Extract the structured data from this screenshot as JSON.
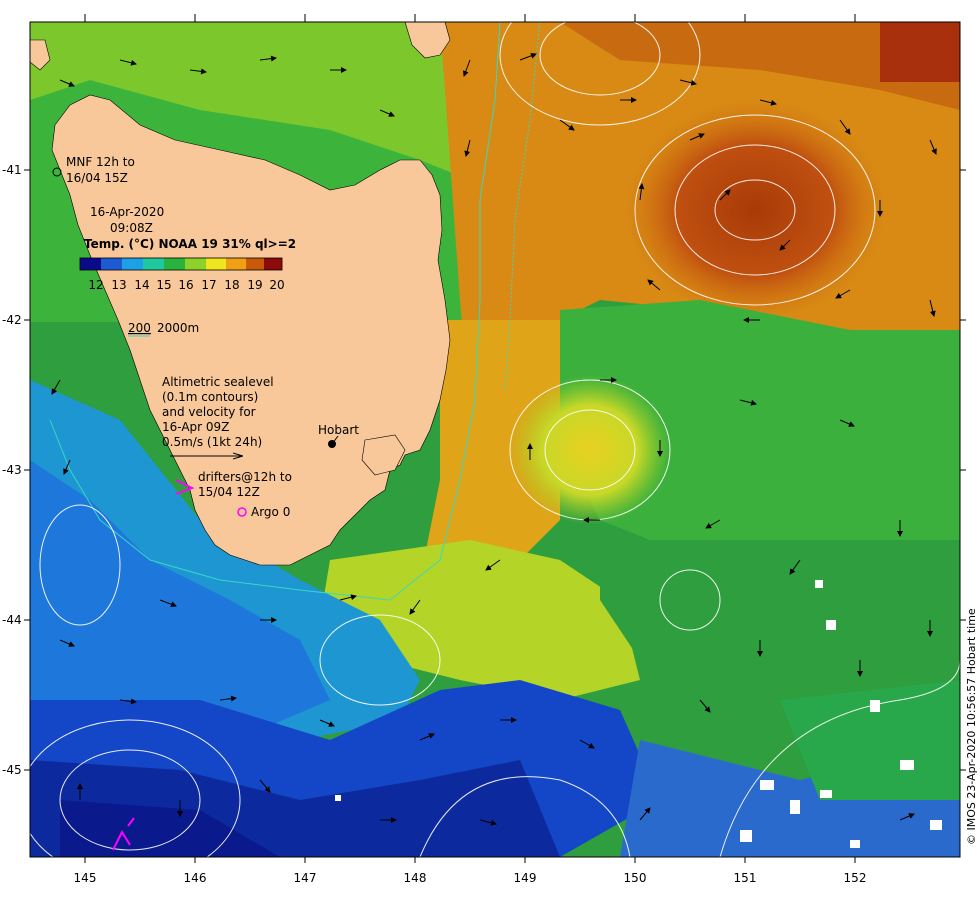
{
  "map": {
    "mooring_label_1": "MNF 12h to",
    "mooring_label_2": "16/04 15Z",
    "date": "16-Apr-2020",
    "time": "09:08Z",
    "sst_title": "Temp. (°C) NOAA 19 31% ql>=2",
    "colorbar_ticks": [
      "12",
      "13",
      "14",
      "15",
      "16",
      "17",
      "18",
      "19",
      "20"
    ],
    "isobath_200": "200",
    "isobath_2000": "2000m",
    "altimetry_lines": [
      "Altimetric sealevel",
      "(0.1m contours)",
      "and velocity for",
      "16-Apr 09Z",
      "0.5m/s (1kt 24h)"
    ],
    "city": "Hobart",
    "drifters_line1": "drifters@12h to",
    "drifters_line2": "15/04 12Z",
    "argo": "Argo 0",
    "credit": "© IMOS 23-Apr-2020 10:56:57 Hobart time",
    "x_ticks": [
      "145",
      "146",
      "147",
      "148",
      "149",
      "150",
      "151",
      "152"
    ],
    "y_ticks": [
      "-41",
      "-42",
      "-43",
      "-44",
      "-45"
    ],
    "colors": {
      "land": "#F8C89A",
      "isobath_200": "#38D8C0",
      "drifter": "#FF00FF",
      "colorbar": [
        "#0A0A8C",
        "#1E5AD2",
        "#1EA0E6",
        "#20C8A0",
        "#28B43C",
        "#8CD228",
        "#F0E61E",
        "#F0A014",
        "#C85A0A",
        "#8C0A0A"
      ]
    }
  }
}
